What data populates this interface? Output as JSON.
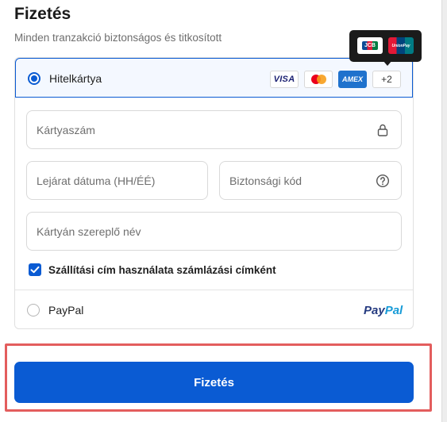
{
  "header": {
    "title": "Fizetés",
    "subtitle": "Minden tranzakció biztonságos és titkosított"
  },
  "payment_methods": {
    "card": {
      "label": "Hitelkártya",
      "selected": true,
      "brands": [
        {
          "name": "VISA",
          "icon": "visa-logo"
        },
        {
          "name": "Mastercard",
          "icon": "mastercard-logo"
        },
        {
          "name": "AMEX",
          "icon": "amex-logo"
        }
      ],
      "more_label": "+2",
      "tooltip_brands": [
        {
          "name": "JCB",
          "icon": "jcb-logo"
        },
        {
          "name": "UnionPay",
          "icon": "unionpay-logo"
        }
      ]
    },
    "paypal": {
      "label": "PayPal",
      "selected": false,
      "logo_text_a": "Pay",
      "logo_text_b": "Pal"
    }
  },
  "form": {
    "card_number": {
      "placeholder": "Kártyaszám",
      "value": "",
      "icon": "lock-icon"
    },
    "expiry": {
      "placeholder": "Lejárat dátuma (HH/ÉÉ)",
      "value": ""
    },
    "security_code": {
      "placeholder": "Biztonsági kód",
      "value": "",
      "icon": "help-icon"
    },
    "name_on_card": {
      "placeholder": "Kártyán szereplő név",
      "value": ""
    },
    "billing_same": {
      "label": "Szállítási cím használata számlázási címként",
      "checked": true
    }
  },
  "submit": {
    "label": "Fizetés"
  },
  "colors": {
    "accent": "#0a5bd3",
    "highlight": "#e35d5d",
    "paypal_dark": "#253b80",
    "paypal_light": "#179bd7"
  }
}
